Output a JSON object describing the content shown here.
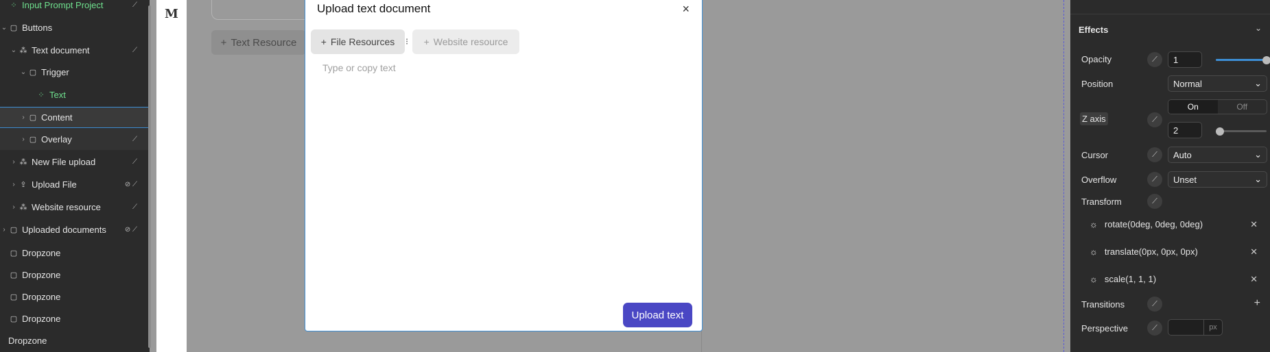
{
  "layers": {
    "items": [
      {
        "label": "Input Prompt Project",
        "icon": "component-icon",
        "chevron": "",
        "action": "unlink-icon"
      },
      {
        "label": "Buttons",
        "icon": "box-icon",
        "chevron": "expanded",
        "action": ""
      },
      {
        "label": "Text document",
        "icon": "slot-icon",
        "chevron": "expanded",
        "action": "unlink-icon"
      },
      {
        "label": "Trigger",
        "icon": "box-icon",
        "chevron": "expanded",
        "action": ""
      },
      {
        "label": "Text",
        "icon": "component-icon",
        "chevron": "",
        "action": ""
      },
      {
        "label": "Content",
        "icon": "box-icon",
        "chevron": "collapsed",
        "action": ""
      },
      {
        "label": "Overlay",
        "icon": "box-icon",
        "chevron": "collapsed",
        "action": "unlink-icon"
      },
      {
        "label": "New File upload",
        "icon": "slot-icon",
        "chevron": "collapsed",
        "action": "unlink-icon"
      },
      {
        "label": "Upload File",
        "icon": "upload-icon",
        "chevron": "collapsed",
        "action": "eye-off-icon"
      },
      {
        "label": "Website resource",
        "icon": "slot-icon",
        "chevron": "collapsed",
        "action": "unlink-icon"
      },
      {
        "label": "Uploaded documents",
        "icon": "box-icon",
        "chevron": "collapsed",
        "action": "eye-off-icon"
      },
      {
        "label": "Dropzone",
        "icon": "box-icon",
        "chevron": "",
        "action": ""
      },
      {
        "label": "Dropzone",
        "icon": "box-icon",
        "chevron": "",
        "action": ""
      },
      {
        "label": "Dropzone",
        "icon": "box-icon",
        "chevron": "",
        "action": ""
      },
      {
        "label": "Dropzone",
        "icon": "box-icon",
        "chevron": "",
        "action": ""
      },
      {
        "label": "Dropzone",
        "icon": "",
        "chevron": "",
        "action": ""
      }
    ]
  },
  "canvas": {
    "logo": "M",
    "text_resource_button": "Text Resource",
    "plus": "+"
  },
  "modal": {
    "title": "Upload text document",
    "close": "×",
    "tabs": {
      "file": "File Resources",
      "website": "Website resource"
    },
    "drag_handle": "⁝",
    "placeholder": "Type or copy text",
    "upload_button": "Upload text"
  },
  "effects": {
    "title": "Effects",
    "chevron": "⌄",
    "opacity": {
      "label": "Opacity",
      "value": "1",
      "slider_fraction": 1.0
    },
    "position": {
      "label": "Position",
      "value": "Normal"
    },
    "z_axis": {
      "label": "Z axis",
      "toggle_on": "On",
      "toggle_off": "Off",
      "value": "2",
      "slider_fraction": 0.0
    },
    "cursor": {
      "label": "Cursor",
      "value": "Auto"
    },
    "overflow": {
      "label": "Overflow",
      "value": "Unset"
    },
    "transform": {
      "label": "Transform",
      "items": [
        "rotate(0deg, 0deg, 0deg)",
        "translate(0px, 0px, 0px)",
        "scale(1, 1, 1)"
      ]
    },
    "transitions": {
      "label": "Transitions",
      "add": "+"
    },
    "perspective": {
      "label": "Perspective",
      "value": "",
      "unit": "px"
    }
  },
  "colors": {
    "accent": "#3d8fd6",
    "upload_button": "#4a47c4",
    "component_green": "#6fe08e"
  }
}
